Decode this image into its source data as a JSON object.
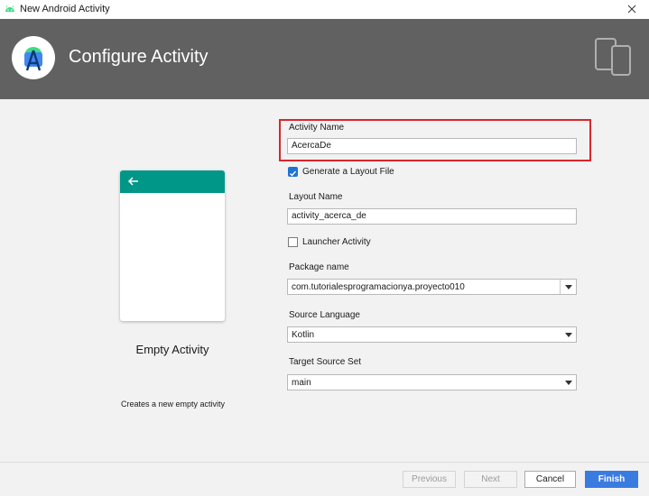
{
  "window": {
    "title": "New Android Activity"
  },
  "header": {
    "title": "Configure Activity"
  },
  "template": {
    "name": "Empty Activity",
    "description": "Creates a new empty activity"
  },
  "form": {
    "activity_name": {
      "label": "Activity Name",
      "value": "AcercaDe"
    },
    "generate_layout": {
      "label": "Generate a Layout File",
      "checked": true
    },
    "layout_name": {
      "label": "Layout Name",
      "value": "activity_acerca_de"
    },
    "launcher_activity": {
      "label": "Launcher Activity",
      "checked": false
    },
    "package_name": {
      "label": "Package name",
      "value": "com.tutorialesprogramacionya.proyecto010"
    },
    "source_language": {
      "label": "Source Language",
      "value": "Kotlin"
    },
    "target_source_set": {
      "label": "Target Source Set",
      "value": "main"
    }
  },
  "footer": {
    "previous_label": "Previous",
    "next_label": "Next",
    "cancel_label": "Cancel",
    "finish_label": "Finish"
  },
  "colors": {
    "header_bg": "#616161",
    "appbar": "#009688",
    "highlight": "#d9262c",
    "primary_button": "#3a7be0",
    "checkbox": "#1e74d2"
  }
}
